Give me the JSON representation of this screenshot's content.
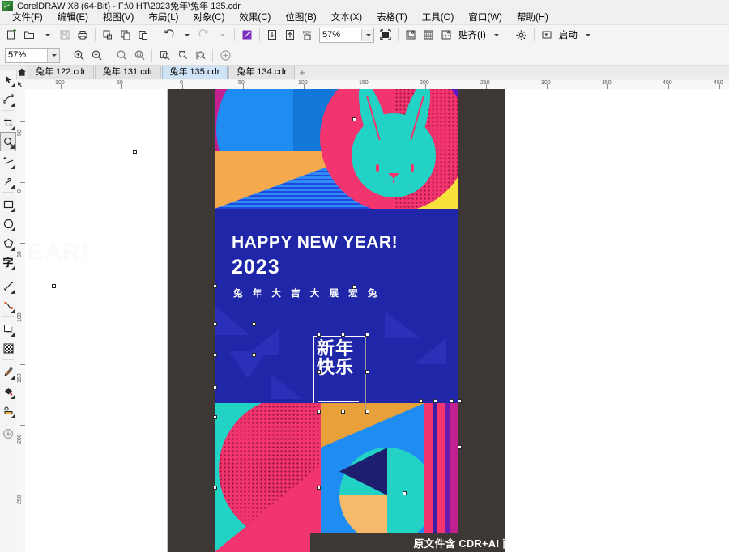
{
  "window": {
    "title": "CorelDRAW X8 (64-Bit) - F:\\0 HT\\2023兔年\\兔年 135.cdr",
    "logo_icon": "coreldraw-balloon-icon"
  },
  "menubar": {
    "items": [
      {
        "label": "文件(F)",
        "name": "menu-file"
      },
      {
        "label": "编辑(E)",
        "name": "menu-edit"
      },
      {
        "label": "视图(V)",
        "name": "menu-view"
      },
      {
        "label": "布局(L)",
        "name": "menu-layout"
      },
      {
        "label": "对象(C)",
        "name": "menu-object"
      },
      {
        "label": "效果(C)",
        "name": "menu-effects"
      },
      {
        "label": "位图(B)",
        "name": "menu-bitmaps"
      },
      {
        "label": "文本(X)",
        "name": "menu-text"
      },
      {
        "label": "表格(T)",
        "name": "menu-table"
      },
      {
        "label": "工具(O)",
        "name": "menu-tools"
      },
      {
        "label": "窗口(W)",
        "name": "menu-window"
      },
      {
        "label": "帮助(H)",
        "name": "menu-help"
      }
    ]
  },
  "toolbar": {
    "zoom_value": "57%",
    "snap_label": "贴齐(I)",
    "launch_label": "启动",
    "buttons": [
      {
        "name": "new-document-button",
        "icon": "new-file-icon"
      },
      {
        "name": "open-document-button",
        "icon": "open-folder-icon"
      },
      {
        "name": "save-button",
        "icon": "floppy-disk-icon"
      },
      {
        "name": "print-button",
        "icon": "printer-icon"
      },
      {
        "name": "cut-button",
        "icon": "scissors-icon"
      },
      {
        "name": "copy-button",
        "icon": "copy-icon"
      },
      {
        "name": "paste-button",
        "icon": "paste-icon"
      },
      {
        "name": "undo-button",
        "icon": "undo-arrow-icon"
      },
      {
        "name": "redo-button",
        "icon": "redo-arrow-icon"
      },
      {
        "name": "search-content-button",
        "icon": "magic-wand-icon"
      },
      {
        "name": "import-button",
        "icon": "import-arrow-icon"
      },
      {
        "name": "export-button",
        "icon": "export-arrow-icon"
      },
      {
        "name": "publish-pdf-button",
        "icon": "pdf-icon"
      },
      {
        "name": "fullscreen-preview-button",
        "icon": "fullscreen-icon"
      },
      {
        "name": "options-button",
        "icon": "gear-icon"
      }
    ]
  },
  "zoom_toolbar": {
    "zoom_value": "57%",
    "buttons": [
      {
        "name": "zoom-in-button",
        "icon": "magnifier-plus-icon"
      },
      {
        "name": "zoom-out-button",
        "icon": "magnifier-minus-icon"
      },
      {
        "name": "zoom-to-selected-button",
        "icon": "magnifier-selection-icon"
      },
      {
        "name": "zoom-to-all-objects-button",
        "icon": "magnifier-all-icon"
      },
      {
        "name": "zoom-to-page-button",
        "icon": "page-fit-icon"
      },
      {
        "name": "zoom-to-page-width-button",
        "icon": "page-width-icon"
      },
      {
        "name": "zoom-to-page-height-button",
        "icon": "page-height-icon"
      },
      {
        "name": "add-toolbar-button",
        "icon": "plus-circle-icon"
      }
    ]
  },
  "tabs": {
    "home_icon": "home-icon",
    "add_label": "+",
    "items": [
      {
        "label": "兔年 122.cdr",
        "active": false
      },
      {
        "label": "兔年 131.cdr",
        "active": false
      },
      {
        "label": "兔年 135.cdr",
        "active": true
      },
      {
        "label": "兔年 134.cdr",
        "active": false
      }
    ]
  },
  "toolbox": {
    "items": [
      {
        "name": "pick-tool",
        "icon": "arrow-cursor-icon",
        "selected": false
      },
      {
        "name": "shape-tool",
        "icon": "node-edit-icon",
        "selected": false
      },
      {
        "name": "crop-tool",
        "icon": "crop-icon",
        "selected": false
      },
      {
        "name": "zoom-tool",
        "icon": "magnifier-icon",
        "selected": true
      },
      {
        "name": "freehand-tool",
        "icon": "pencil-path-icon",
        "selected": false
      },
      {
        "name": "smart-fill-tool",
        "icon": "curve-icon",
        "selected": false
      },
      {
        "name": "rectangle-tool",
        "icon": "rectangle-icon",
        "selected": false
      },
      {
        "name": "ellipse-tool",
        "icon": "ellipse-icon",
        "selected": false
      },
      {
        "name": "polygon-tool",
        "icon": "polygon-icon",
        "selected": false
      },
      {
        "name": "text-tool",
        "icon": "text-character-icon",
        "selected": false
      },
      {
        "name": "dimension-tool",
        "icon": "dimension-line-icon",
        "selected": false
      },
      {
        "name": "connector-tool",
        "icon": "connector-icon",
        "selected": false
      },
      {
        "name": "drop-shadow-tool",
        "icon": "drop-shadow-icon",
        "selected": false
      },
      {
        "name": "transparency-tool",
        "icon": "checkerboard-icon",
        "selected": false
      },
      {
        "name": "color-eyedropper-tool",
        "icon": "eyedropper-icon",
        "selected": false
      },
      {
        "name": "fill-tool",
        "icon": "paint-bucket-icon",
        "selected": false
      },
      {
        "name": "interactive-fill-tool",
        "icon": "interactive-fill-icon",
        "selected": false
      },
      {
        "name": "add-tool-button",
        "icon": "plus-circle-icon",
        "selected": false
      }
    ]
  },
  "rulers": {
    "horizontal_labels": [
      "100",
      "50",
      "0",
      "50",
      "100",
      "150",
      "200",
      "250",
      "300",
      "350",
      "400",
      "450"
    ],
    "vertical_labels": [
      "50",
      "0",
      "50",
      "100",
      "150",
      "200",
      "250"
    ],
    "units": "mm"
  },
  "artwork": {
    "headline": "HAPPY NEW YEAR!",
    "year": "2023",
    "subtitle_cn": "兔 年 大 吉    大 展 宏 兔",
    "selected_text": "新年\n快乐",
    "selected_text_lines": [
      "新年",
      "快乐"
    ],
    "footer_caption": "原文件含 CDR+AI 两种版本",
    "ghost_text": "Y NEW YEAR!",
    "colors": {
      "magenta": "#C22090",
      "blue": "#1E8CF0",
      "deep_blue": "#2026A8",
      "orange": "#F7A94E",
      "pink": "#F2356E",
      "teal": "#22D3C5",
      "yellow": "#F7E23C",
      "purple": "#5F17C9",
      "navy": "#1D1F6E",
      "canvas_dark": "#3D3735"
    }
  }
}
